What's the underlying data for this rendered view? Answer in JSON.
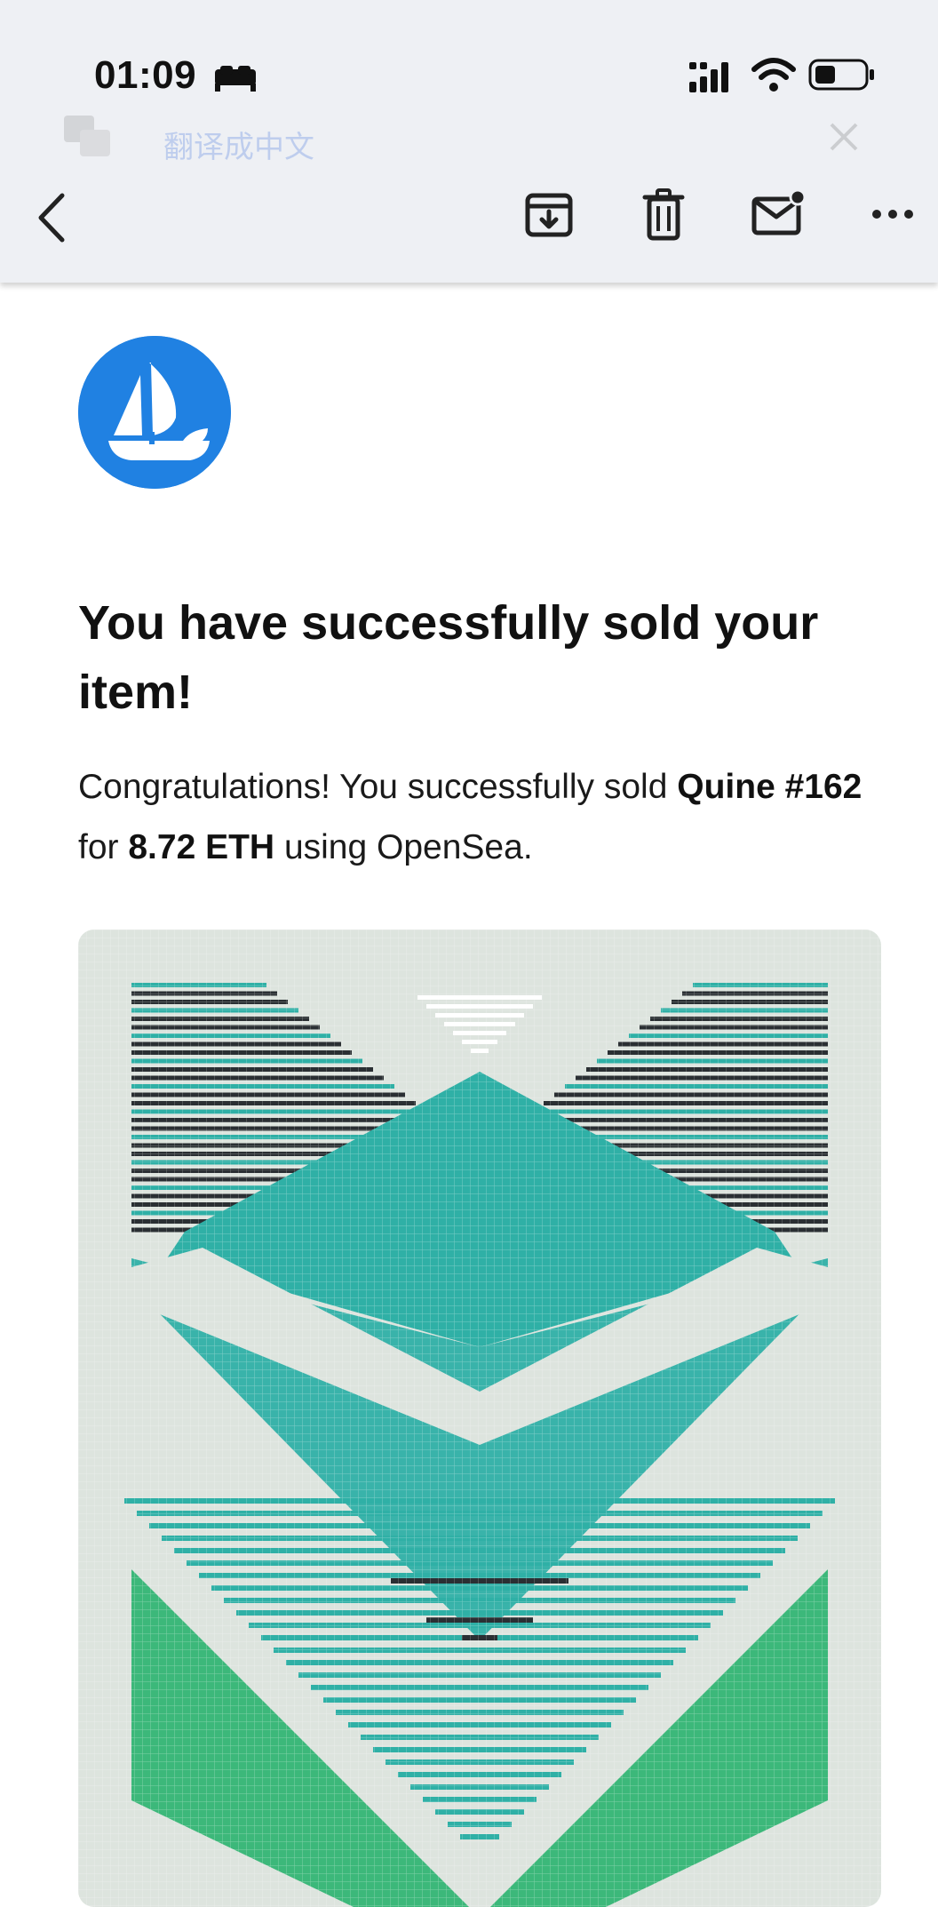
{
  "status_bar": {
    "time": "01:09",
    "icons": [
      "bed-icon",
      "cellular-signal-icon",
      "wifi-icon",
      "battery-icon"
    ]
  },
  "translate_bar": {
    "text": "翻译成中文",
    "icons": [
      "translate-icon",
      "close-icon"
    ]
  },
  "toolbar": {
    "icons": [
      "back-icon",
      "archive-icon",
      "trash-icon",
      "mark-unread-icon",
      "more-icon"
    ]
  },
  "email": {
    "logo": "opensea-logo",
    "headline": "You have successfully sold your item!",
    "body": {
      "intro": "Congratulations! You successfully sold ",
      "item_name": "Quine #162",
      "for_text": " for ",
      "price": "8.72 ETH",
      "outro": " using OpenSea."
    },
    "artwork": "item-image"
  },
  "colors": {
    "brand_blue": "#2081e2",
    "toolbar_bg": "#eef0f4",
    "art_bg": "#dde4de",
    "art_teal": "#2fb0a6",
    "art_dark": "#2a2f33",
    "art_green": "#3cb87a"
  }
}
